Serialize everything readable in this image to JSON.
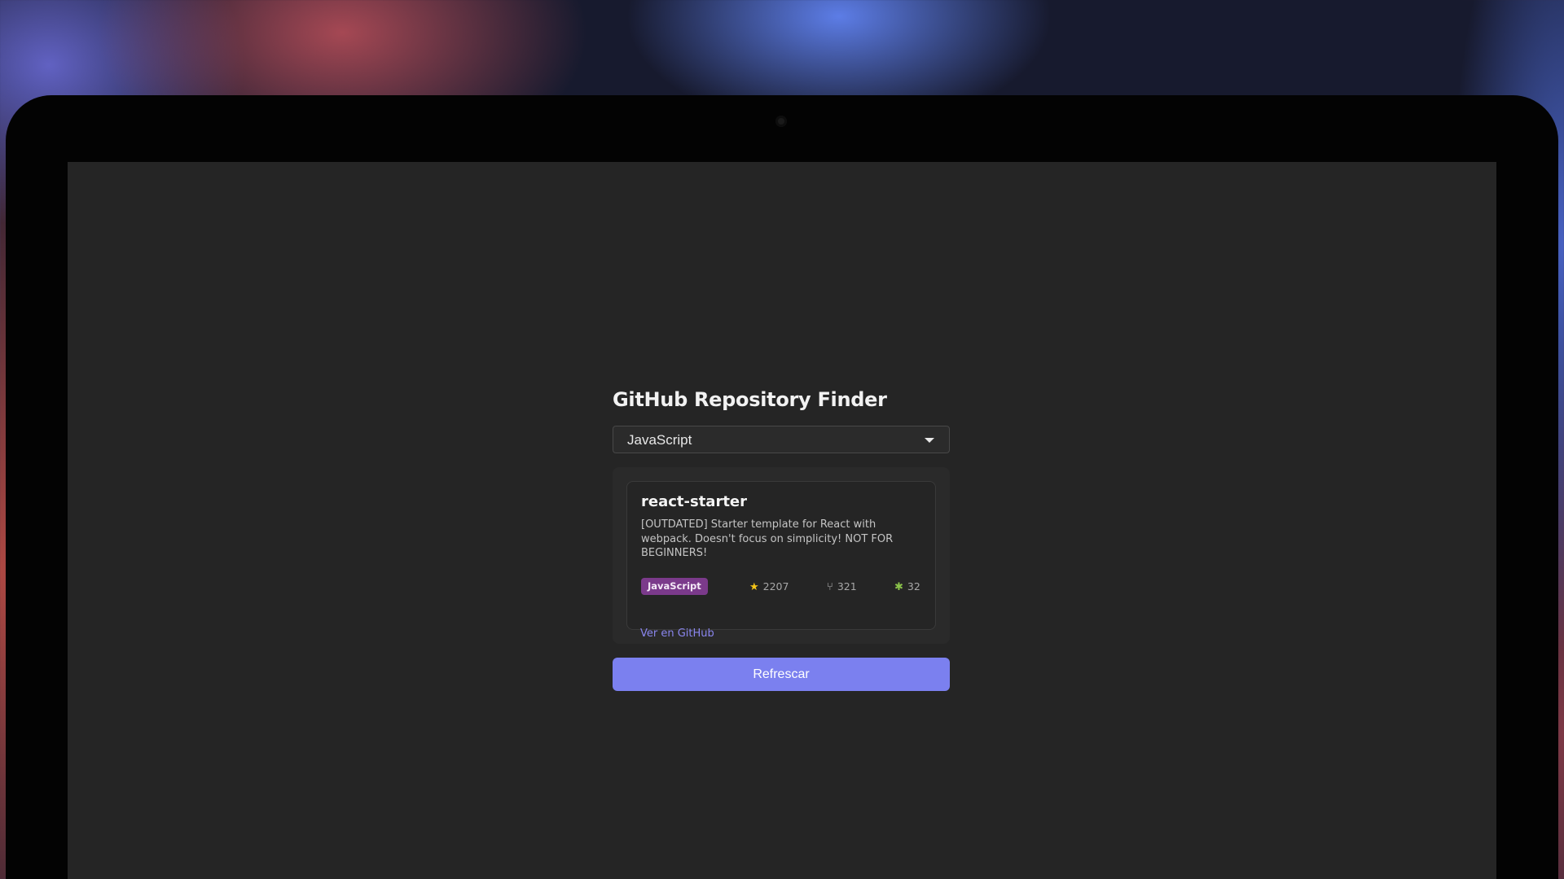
{
  "app": {
    "title": "GitHub Repository Finder"
  },
  "language_select": {
    "selected": "JavaScript",
    "caret_icon": "chevron-down-icon"
  },
  "repo": {
    "name": "react-starter",
    "description": "[OUTDATED] Starter template for React with webpack. Doesn't focus on simplicity! NOT FOR BEGINNERS!",
    "language": "JavaScript",
    "stars": "2207",
    "forks": "321",
    "issues": "32",
    "link_label": "Ver en GitHub",
    "icons": {
      "stars": "star-icon",
      "forks": "fork-icon",
      "issues": "bug-icon"
    }
  },
  "refresh_button": {
    "label": "Refrescar"
  },
  "colors": {
    "accent": "#7b80ef",
    "link": "#8a86ef",
    "language_badge": "#7b3a8b",
    "screen_background": "#252525"
  }
}
